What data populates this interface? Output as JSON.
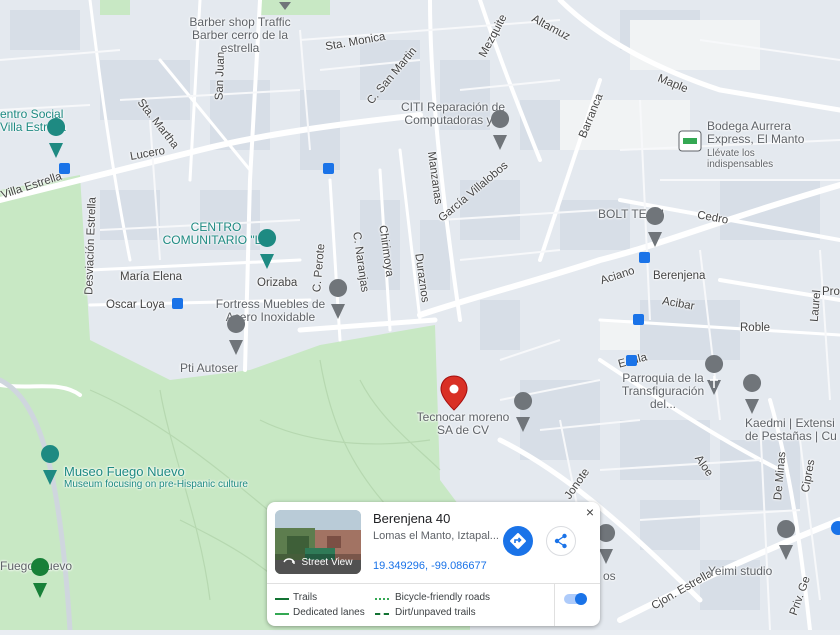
{
  "map": {
    "streets": [
      "Sta. Monica",
      "C. San Martin",
      "Mezquite",
      "Altamuz",
      "Maple",
      "Barranca",
      "San Juan",
      "Sta. Martha",
      "Lucero",
      "Desviación Estrella",
      "Villa Estrella",
      "Manzanas",
      "García Villalobos",
      "Chirimoya",
      "C. Naranjas",
      "Duraznos",
      "C. Perote",
      "Orizaba",
      "María Elena",
      "Oscar Loya",
      "Aciano",
      "Berenjena",
      "Acibar",
      "Cedro",
      "Roble",
      "Enula",
      "Laurel",
      "Pro",
      "Jonote",
      "Aloe",
      "De Minas",
      "Cipres",
      "Cjon. Estrella",
      "Priv. Ge"
    ],
    "pois": {
      "barber": "Barber shop Traffic Barber cerro de la estrella",
      "centro_social": "entro Social Villa Estrella",
      "citi": "CITI Reparación de Computadoras y...",
      "bodega_title": "Bodega Aurrera Express, El Manto",
      "bodega_sub": "Llévate los indispensables",
      "bolt": "BOLT TECH",
      "centro_comunitario": "CENTRO COMUNITARIO \"LA",
      "fortress": "Fortress Muebles de Acero Inoxidable",
      "pti": "Pti Autoser",
      "tecnocar": "Tecnocar moreno SA de CV",
      "parroquia": "Parroquia de la Transfiguración del...",
      "kaedmi": "Kaedmi | Extensi de Pestañas | Cu",
      "museo_title": "Museo Fuego Nuevo",
      "museo_sub": "Museum focusing on pre-Hispanic culture",
      "fuego_nuevo": "Fuego Nuevo",
      "yeimi": "Yeimi studio",
      "os": "os"
    }
  },
  "card": {
    "title": "Berenjena 40",
    "address": "Lomas el Manto, Iztapal...",
    "coords": "19.349296, -99.086677",
    "street_view_label": "Street View",
    "close": "×"
  },
  "legend": {
    "trails": "Trails",
    "dedicated_lanes": "Dedicated lanes",
    "bicycle_friendly": "Bicycle-friendly roads",
    "dirt_trails": "Dirt/unpaved trails",
    "toggle_on": true
  },
  "colors": {
    "park": "#c8e8c4",
    "road": "#ffffff",
    "block": "#dde3ea",
    "pin_red": "#d93025",
    "pin_grey": "#70757a",
    "pin_teal": "#1e8a82",
    "transit": "#1a73e8",
    "accent": "#1a73e8"
  },
  "icons": [
    "search-icon"
  ]
}
